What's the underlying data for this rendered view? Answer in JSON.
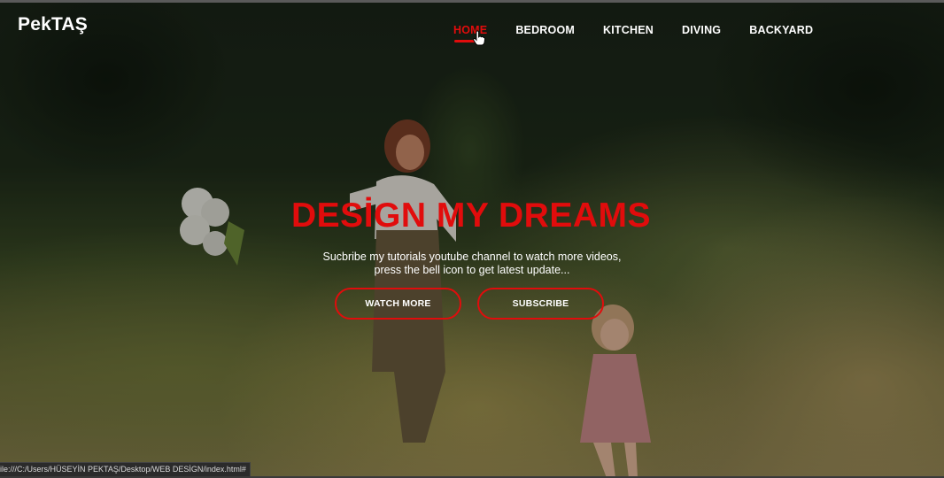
{
  "header": {
    "logo": "PekTAŞ",
    "nav": [
      {
        "label": "HOME",
        "active": true
      },
      {
        "label": "BEDROOM",
        "active": false
      },
      {
        "label": "KITCHEN",
        "active": false
      },
      {
        "label": "DIVING",
        "active": false
      },
      {
        "label": "BACKYARD",
        "active": false
      }
    ]
  },
  "hero": {
    "title": "DESİGN MY DREAMS",
    "subtitle_line1": "Sucbribe my tutorials youtube channel to watch more videos,",
    "subtitle_line2": "press the bell icon to get latest update...",
    "watch_button": "WATCH MORE",
    "subscribe_button": "SUBSCRIBE"
  },
  "status_bar": {
    "url": "ile:///C:/Users/HÜSEYİN PEKTAŞ/Desktop/WEB DESİGN/index.html#"
  },
  "colors": {
    "accent": "#e10c0c",
    "text": "#ffffff"
  },
  "icons": {
    "cursor": "hand-pointer-icon"
  }
}
